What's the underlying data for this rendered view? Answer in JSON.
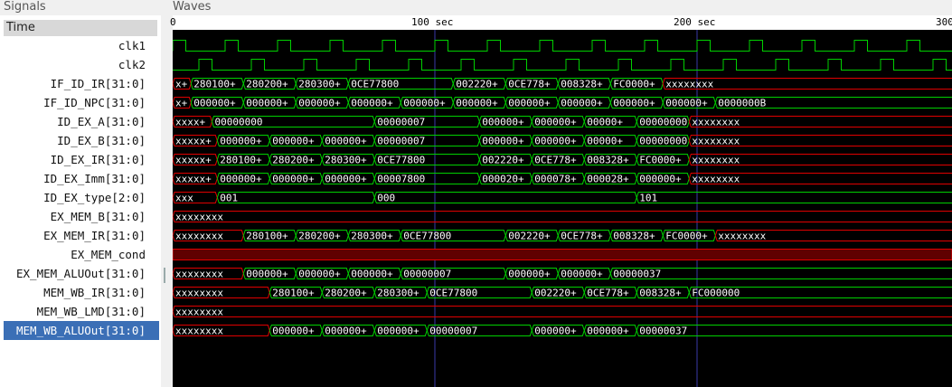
{
  "panels": {
    "signals_title": "Signals",
    "waves_title": "Waves"
  },
  "time_header": "Time",
  "ruler": {
    "ticks": [
      {
        "t": 0,
        "label": "0"
      },
      {
        "t": 100,
        "label": "100 sec"
      },
      {
        "t": 200,
        "label": "200 sec"
      },
      {
        "t": 300,
        "label": "300"
      }
    ]
  },
  "colors": {
    "valid": "#00d000",
    "invalid": "#e00000",
    "cursor": "#3a3aaa",
    "selected": "#3b6fb6"
  },
  "signals": [
    {
      "name": "clk1",
      "kind": "clock",
      "phase": 0
    },
    {
      "name": "clk2",
      "kind": "clock",
      "phase": 10
    },
    {
      "name": "IF_ID_IR[31:0]",
      "kind": "bus",
      "segments": [
        {
          "t": 0,
          "v": "x+"
        },
        {
          "t": 7,
          "v": "280100+"
        },
        {
          "t": 27,
          "v": "280200+"
        },
        {
          "t": 47,
          "v": "280300+"
        },
        {
          "t": 67,
          "v": "0CE77800"
        },
        {
          "t": 107,
          "v": "002220+"
        },
        {
          "t": 127,
          "v": "0CE778+"
        },
        {
          "t": 147,
          "v": "008328+"
        },
        {
          "t": 167,
          "v": "FC0000+"
        },
        {
          "t": 187,
          "v": "xxxxxxxx"
        }
      ]
    },
    {
      "name": "IF_ID_NPC[31:0]",
      "kind": "bus",
      "segments": [
        {
          "t": 0,
          "v": "x+"
        },
        {
          "t": 7,
          "v": "000000+"
        },
        {
          "t": 27,
          "v": "000000+"
        },
        {
          "t": 47,
          "v": "000000+"
        },
        {
          "t": 67,
          "v": "000000+"
        },
        {
          "t": 87,
          "v": "000000+"
        },
        {
          "t": 107,
          "v": "000000+"
        },
        {
          "t": 127,
          "v": "000000+"
        },
        {
          "t": 147,
          "v": "000000+"
        },
        {
          "t": 167,
          "v": "000000+"
        },
        {
          "t": 187,
          "v": "000000+"
        },
        {
          "t": 207,
          "v": "0000000B"
        }
      ]
    },
    {
      "name": "ID_EX_A[31:0]",
      "kind": "bus",
      "segments": [
        {
          "t": 0,
          "v": "xxxx+"
        },
        {
          "t": 15,
          "v": "00000000"
        },
        {
          "t": 77,
          "v": "00000007"
        },
        {
          "t": 117,
          "v": "000000+"
        },
        {
          "t": 137,
          "v": "000000+"
        },
        {
          "t": 157,
          "v": "00000+"
        },
        {
          "t": 177,
          "v": "00000000"
        },
        {
          "t": 197,
          "v": "xxxxxxxx"
        }
      ]
    },
    {
      "name": "ID_EX_B[31:0]",
      "kind": "bus",
      "segments": [
        {
          "t": 0,
          "v": "xxxxx+"
        },
        {
          "t": 17,
          "v": "000000+"
        },
        {
          "t": 37,
          "v": "000000+"
        },
        {
          "t": 57,
          "v": "000000+"
        },
        {
          "t": 77,
          "v": "00000007"
        },
        {
          "t": 117,
          "v": "000000+"
        },
        {
          "t": 137,
          "v": "000000+"
        },
        {
          "t": 157,
          "v": "00000+"
        },
        {
          "t": 177,
          "v": "00000000"
        },
        {
          "t": 197,
          "v": "xxxxxxxx"
        }
      ]
    },
    {
      "name": "ID_EX_IR[31:0]",
      "kind": "bus",
      "segments": [
        {
          "t": 0,
          "v": "xxxxx+"
        },
        {
          "t": 17,
          "v": "280100+"
        },
        {
          "t": 37,
          "v": "280200+"
        },
        {
          "t": 57,
          "v": "280300+"
        },
        {
          "t": 77,
          "v": "0CE77800"
        },
        {
          "t": 117,
          "v": "002220+"
        },
        {
          "t": 137,
          "v": "0CE778+"
        },
        {
          "t": 157,
          "v": "008328+"
        },
        {
          "t": 177,
          "v": "FC0000+"
        },
        {
          "t": 197,
          "v": "xxxxxxxx"
        }
      ]
    },
    {
      "name": "ID_EX_Imm[31:0]",
      "kind": "bus",
      "segments": [
        {
          "t": 0,
          "v": "xxxxx+"
        },
        {
          "t": 17,
          "v": "000000+"
        },
        {
          "t": 37,
          "v": "000000+"
        },
        {
          "t": 57,
          "v": "000000+"
        },
        {
          "t": 77,
          "v": "00007800"
        },
        {
          "t": 117,
          "v": "000020+"
        },
        {
          "t": 137,
          "v": "000078+"
        },
        {
          "t": 157,
          "v": "000028+"
        },
        {
          "t": 177,
          "v": "000000+"
        },
        {
          "t": 197,
          "v": "xxxxxxxx"
        }
      ]
    },
    {
      "name": "ID_EX_type[2:0]",
      "kind": "bus",
      "segments": [
        {
          "t": 0,
          "v": "xxx"
        },
        {
          "t": 17,
          "v": "001"
        },
        {
          "t": 77,
          "v": "000"
        },
        {
          "t": 177,
          "v": "101"
        }
      ]
    },
    {
      "name": "EX_MEM_B[31:0]",
      "kind": "bus",
      "segments": [
        {
          "t": 0,
          "v": "xxxxxxxx"
        }
      ]
    },
    {
      "name": "EX_MEM_IR[31:0]",
      "kind": "bus",
      "segments": [
        {
          "t": 0,
          "v": "xxxxxxxx"
        },
        {
          "t": 27,
          "v": "280100+"
        },
        {
          "t": 47,
          "v": "280200+"
        },
        {
          "t": 67,
          "v": "280300+"
        },
        {
          "t": 87,
          "v": "0CE77800"
        },
        {
          "t": 127,
          "v": "002220+"
        },
        {
          "t": 147,
          "v": "0CE778+"
        },
        {
          "t": 167,
          "v": "008328+"
        },
        {
          "t": 187,
          "v": "FC0000+"
        },
        {
          "t": 207,
          "v": "xxxxxxxx"
        }
      ]
    },
    {
      "name": "EX_MEM_cond",
      "kind": "xline"
    },
    {
      "name": "EX_MEM_ALUOut[31:0]",
      "kind": "bus",
      "segments": [
        {
          "t": 0,
          "v": "xxxxxxxx"
        },
        {
          "t": 27,
          "v": "000000+"
        },
        {
          "t": 47,
          "v": "000000+"
        },
        {
          "t": 67,
          "v": "000000+"
        },
        {
          "t": 87,
          "v": "00000007"
        },
        {
          "t": 127,
          "v": "000000+"
        },
        {
          "t": 147,
          "v": "000000+"
        },
        {
          "t": 167,
          "v": "00000037"
        }
      ]
    },
    {
      "name": "MEM_WB_IR[31:0]",
      "kind": "bus",
      "segments": [
        {
          "t": 0,
          "v": "xxxxxxxx"
        },
        {
          "t": 37,
          "v": "280100+"
        },
        {
          "t": 57,
          "v": "280200+"
        },
        {
          "t": 77,
          "v": "280300+"
        },
        {
          "t": 97,
          "v": "0CE77800"
        },
        {
          "t": 137,
          "v": "002220+"
        },
        {
          "t": 157,
          "v": "0CE778+"
        },
        {
          "t": 177,
          "v": "008328+"
        },
        {
          "t": 197,
          "v": "FC000000"
        }
      ]
    },
    {
      "name": "MEM_WB_LMD[31:0]",
      "kind": "bus",
      "segments": [
        {
          "t": 0,
          "v": "xxxxxxxx"
        }
      ]
    },
    {
      "name": "MEM_WB_ALUOut[31:0]",
      "kind": "bus",
      "selected": true,
      "segments": [
        {
          "t": 0,
          "v": "xxxxxxxx"
        },
        {
          "t": 37,
          "v": "000000+"
        },
        {
          "t": 57,
          "v": "000000+"
        },
        {
          "t": 77,
          "v": "000000+"
        },
        {
          "t": 97,
          "v": "00000007"
        },
        {
          "t": 137,
          "v": "000000+"
        },
        {
          "t": 157,
          "v": "000000+"
        },
        {
          "t": 177,
          "v": "00000037"
        }
      ]
    }
  ]
}
